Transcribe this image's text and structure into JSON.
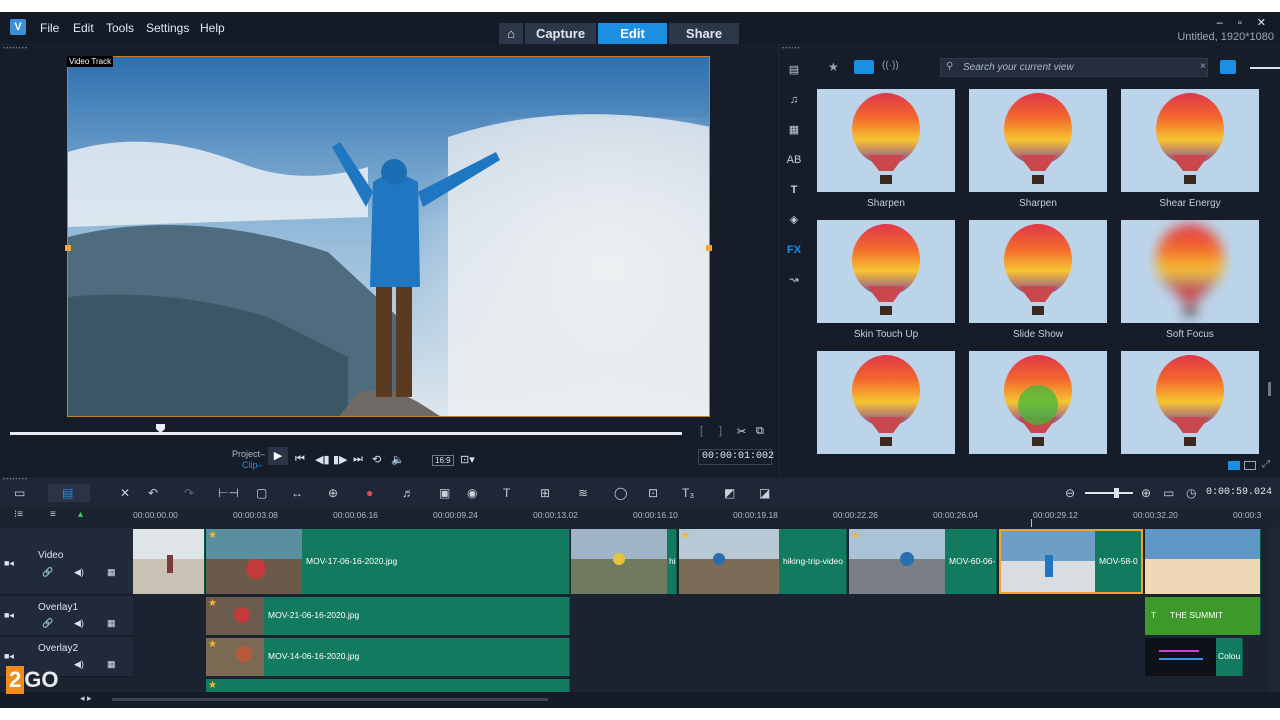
{
  "menu": {
    "file": "File",
    "edit": "Edit",
    "tools": "Tools",
    "settings": "Settings",
    "help": "Help"
  },
  "tabs": {
    "home_icon": "home-icon",
    "capture": "Capture",
    "edit": "Edit",
    "share": "Share"
  },
  "window": {
    "project_info": "Untitled, 1920*1080",
    "controls": "– ▫ ✕"
  },
  "preview": {
    "track_label": "Video Track",
    "project_label": "Project",
    "clip_label": "Clip",
    "timecode": "00:00:01:002",
    "aspect": "16:9"
  },
  "library": {
    "search_placeholder": "Search your current view",
    "items": [
      {
        "label": "Sharpen",
        "effect": "none"
      },
      {
        "label": "Sharpen",
        "effect": "none"
      },
      {
        "label": "Shear Energy",
        "effect": "none"
      },
      {
        "label": "Skin Touch Up",
        "effect": "none"
      },
      {
        "label": "Slide Show",
        "effect": "none"
      },
      {
        "label": "Soft Focus",
        "effect": "blur"
      },
      {
        "label": "",
        "effect": "none"
      },
      {
        "label": "",
        "effect": "green"
      },
      {
        "label": "",
        "effect": "none"
      }
    ]
  },
  "timeline": {
    "duration": "0:00:59.024",
    "ruler": [
      "00:00:00.00",
      "00:00:03.08",
      "00:00:06.16",
      "00:00:09.24",
      "00:00:13.02",
      "00:00:16.10",
      "00:00:19.18",
      "00:00:22.26",
      "00:00:26.04",
      "00:00:29.12",
      "00:00:32.20",
      "00:00:3"
    ],
    "tracks": [
      {
        "name": "Video"
      },
      {
        "name": "Overlay1"
      },
      {
        "name": "Overlay2"
      }
    ],
    "video_clips": [
      {
        "label": "MOV-17-06-16-2020.jpg"
      },
      {
        "label": "hi"
      },
      {
        "label": "hiking-trip-video"
      },
      {
        "label": "MOV-60-06-"
      },
      {
        "label": "MOV-58-0"
      }
    ],
    "overlay1_clip": "MOV-21-06-16-2020.jpg",
    "overlay1_title": "THE SUMMIT",
    "overlay2_clip": "MOV-14-06-16-2020.jpg",
    "overlay2_title": "Colou"
  },
  "watermark": "2GO"
}
